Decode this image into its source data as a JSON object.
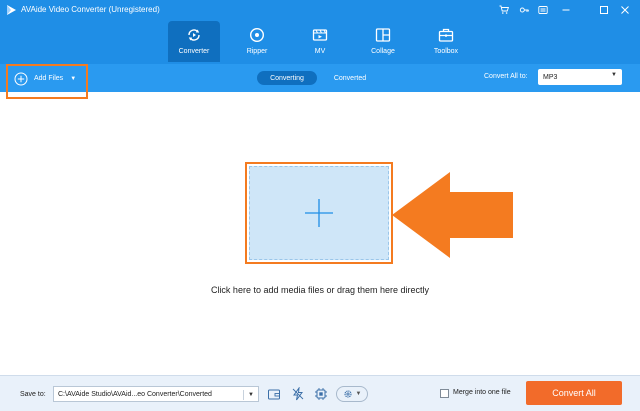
{
  "app": {
    "title": "AVAide Video Converter (Unregistered)"
  },
  "window_controls": [
    "cart-icon",
    "key-icon",
    "menu-icon",
    "minimize-icon",
    "maximize-icon",
    "close-icon"
  ],
  "nav": {
    "tabs": [
      {
        "label": "Converter",
        "icon": "converter-icon",
        "active": true
      },
      {
        "label": "Ripper",
        "icon": "disc-icon",
        "active": false
      },
      {
        "label": "MV",
        "icon": "mv-icon",
        "active": false
      },
      {
        "label": "Collage",
        "icon": "collage-icon",
        "active": false
      },
      {
        "label": "Toolbox",
        "icon": "toolbox-icon",
        "active": false
      }
    ]
  },
  "toolbar": {
    "add_files_label": "Add Files",
    "segments": {
      "converting": "Converting",
      "converted": "Converted"
    },
    "convert_all_to_label": "Convert All to:",
    "format_value": "MP3"
  },
  "main": {
    "drop_hint": "Click here to add media files or drag them here directly"
  },
  "bottom": {
    "save_to_label": "Save to:",
    "save_path": "C:\\AVAide Studio\\AVAid...eo Converter\\Converted",
    "merge_label": "Merge into one file",
    "merge_checked": false,
    "convert_all_label": "Convert All"
  },
  "colors": {
    "header_blue": "#1f8ee6",
    "active_tab": "#0f6fbf",
    "highlight_orange": "#f47b20",
    "convert_button": "#f26b2a",
    "drop_zone": "#cfe6f8"
  }
}
